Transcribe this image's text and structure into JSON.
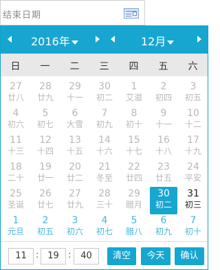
{
  "input": {
    "placeholder": "结束日期"
  },
  "header": {
    "year_label": "2016年",
    "month_label": "12月"
  },
  "weekdays": [
    "日",
    "一",
    "二",
    "三",
    "四",
    "五",
    "六"
  ],
  "days": [
    [
      {
        "d": "27",
        "l": "廿八",
        "t": "prev"
      },
      {
        "d": "28",
        "l": "廿九",
        "t": "prev"
      },
      {
        "d": "29",
        "l": "十一",
        "t": "prev"
      },
      {
        "d": "30",
        "l": "初二",
        "t": "prev"
      },
      {
        "d": "1",
        "l": "艾滋",
        "t": "prev"
      },
      {
        "d": "2",
        "l": "初四",
        "t": "prev"
      },
      {
        "d": "3",
        "l": "初五",
        "t": "prev"
      }
    ],
    [
      {
        "d": "4",
        "l": "初六",
        "t": "prev"
      },
      {
        "d": "5",
        "l": "初七",
        "t": "prev"
      },
      {
        "d": "6",
        "l": "大雪",
        "t": "prev"
      },
      {
        "d": "7",
        "l": "初九",
        "t": "prev"
      },
      {
        "d": "8",
        "l": "初十",
        "t": "prev"
      },
      {
        "d": "9",
        "l": "十一",
        "t": "prev"
      },
      {
        "d": "10",
        "l": "十二",
        "t": "prev"
      }
    ],
    [
      {
        "d": "11",
        "l": "十三",
        "t": "prev"
      },
      {
        "d": "12",
        "l": "十四",
        "t": "prev"
      },
      {
        "d": "13",
        "l": "十五",
        "t": "prev"
      },
      {
        "d": "14",
        "l": "十六",
        "t": "prev"
      },
      {
        "d": "15",
        "l": "十七",
        "t": "prev"
      },
      {
        "d": "16",
        "l": "十八",
        "t": "prev"
      },
      {
        "d": "17",
        "l": "十九",
        "t": "prev"
      }
    ],
    [
      {
        "d": "18",
        "l": "二十",
        "t": "prev"
      },
      {
        "d": "19",
        "l": "廿一",
        "t": "prev"
      },
      {
        "d": "20",
        "l": "廿二",
        "t": "prev"
      },
      {
        "d": "21",
        "l": "冬至",
        "t": "prev"
      },
      {
        "d": "22",
        "l": "廿四",
        "t": "prev"
      },
      {
        "d": "23",
        "l": "廿五",
        "t": "prev"
      },
      {
        "d": "24",
        "l": "平安",
        "t": "prev"
      }
    ],
    [
      {
        "d": "25",
        "l": "圣诞",
        "t": "prev"
      },
      {
        "d": "26",
        "l": "廿七",
        "t": "prev"
      },
      {
        "d": "27",
        "l": "廿九",
        "t": "prev"
      },
      {
        "d": "28",
        "l": "三十",
        "t": "prev"
      },
      {
        "d": "29",
        "l": "腊月",
        "t": "prev"
      },
      {
        "d": "30",
        "l": "初二",
        "t": "sel"
      },
      {
        "d": "31",
        "l": "初三",
        "t": "cur"
      }
    ],
    [
      {
        "d": "1",
        "l": "元旦",
        "t": "next"
      },
      {
        "d": "2",
        "l": "初五",
        "t": "next"
      },
      {
        "d": "3",
        "l": "初六",
        "t": "next"
      },
      {
        "d": "4",
        "l": "初七",
        "t": "next"
      },
      {
        "d": "5",
        "l": "腊八",
        "t": "next"
      },
      {
        "d": "6",
        "l": "初九",
        "t": "next"
      },
      {
        "d": "7",
        "l": "初十",
        "t": "next"
      }
    ]
  ],
  "time": {
    "hour": "11",
    "minute": "19",
    "second": "40"
  },
  "buttons": {
    "clear": "清空",
    "today": "今天",
    "confirm": "确认"
  },
  "colors": {
    "accent": "#16a6d0",
    "selected": "#16a6d0",
    "muted_day": "#b8b8b8",
    "next_month_day": "#44b6dc"
  }
}
